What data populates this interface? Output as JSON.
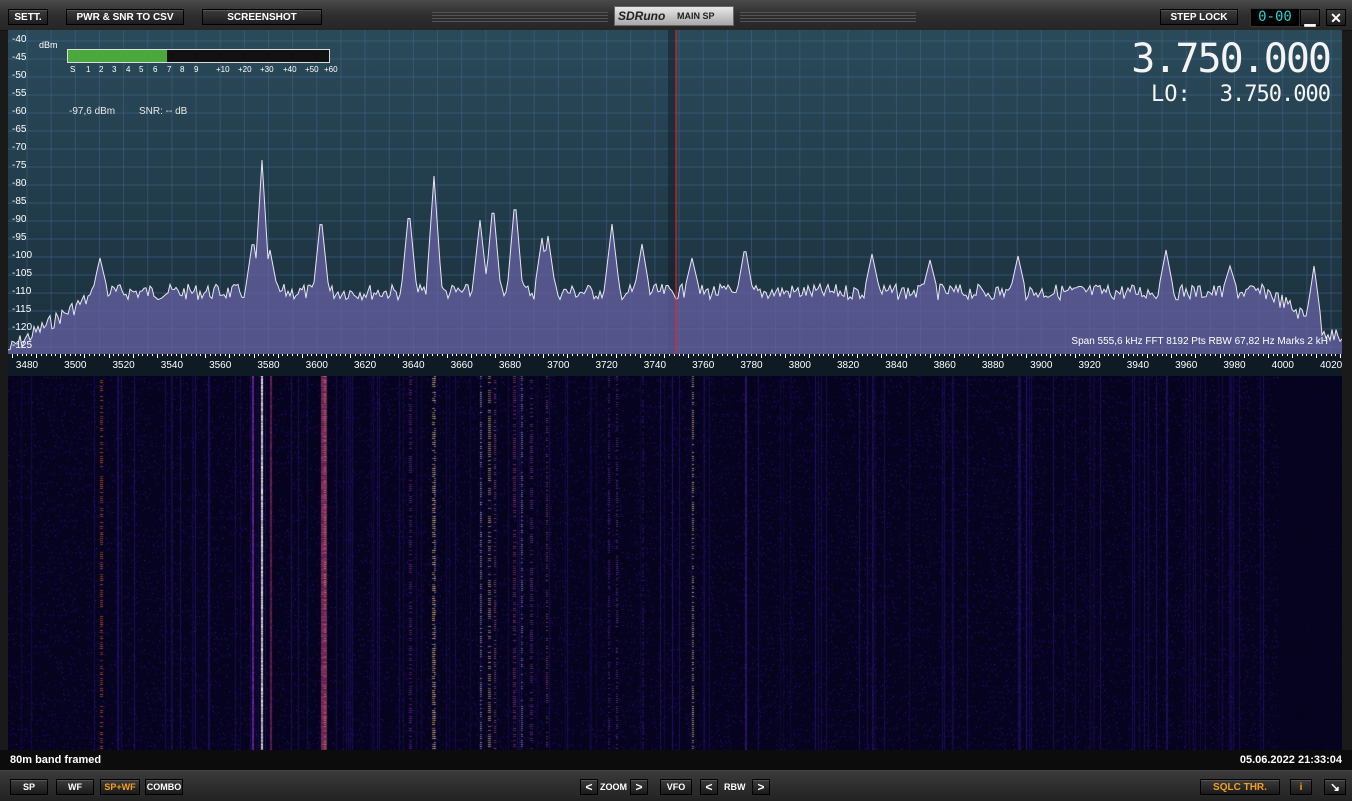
{
  "toolbar": {
    "settings": "SETT.",
    "pwr_snr": "PWR & SNR TO CSV",
    "screenshot": "SCREENSHOT",
    "logo": "SDRuno",
    "panel": "MAIN SP",
    "step_lock": "STEP LOCK",
    "clock": "0-00",
    "minimize": "▁",
    "close": "✕"
  },
  "spectrum": {
    "dbm_unit": "dBm",
    "db_scale": [
      "-40",
      "-45",
      "-50",
      "-55",
      "-60",
      "-65",
      "-70",
      "-75",
      "-80",
      "-85",
      "-90",
      "-95",
      "-100",
      "-105",
      "-110",
      "-115",
      "-120",
      "-125"
    ],
    "smeter_ticks": [
      "S",
      "1",
      "2",
      "3",
      "4",
      "5",
      "6",
      "7",
      "8",
      "9",
      "+10",
      "+20",
      "+30",
      "+40",
      "+50",
      "+60"
    ],
    "smeter_level": 0.38,
    "level": "-97,6 dBm",
    "snr": "SNR: -- dB",
    "frequency": "3.750.000",
    "lo_label": "LO:",
    "lo_value": "3.750.000",
    "info": "Span 555,6 kHz   FFT 8192 Pts   RBW 67,82 Hz   Marks 2 kH"
  },
  "axis": {
    "ticks": [
      "3480",
      "3500",
      "3520",
      "3540",
      "3560",
      "3580",
      "3600",
      "3620",
      "3640",
      "3660",
      "3680",
      "3700",
      "3720",
      "3740",
      "3760",
      "3780",
      "3800",
      "3820",
      "3840",
      "3860",
      "3880",
      "3900",
      "3920",
      "3940",
      "3960",
      "3980",
      "4000",
      "4020"
    ]
  },
  "status": {
    "left": "80m band framed",
    "right": "05.06.2022 21:33:04"
  },
  "bottom": {
    "sp": "SP",
    "wf": "WF",
    "spwf": "SP+WF",
    "combo": "COMBO",
    "zoom_prev": "<",
    "zoom": "ZOOM",
    "zoom_next": ">",
    "vfo": "VFO",
    "rbw_prev": "<",
    "rbw": "RBW",
    "rbw_next": ">",
    "sqlc": "SQLC THR.",
    "info": "i",
    "corner": "↘"
  },
  "colors": {
    "accent": "#f0a020",
    "spectrum_bg": "#2a4a5a",
    "spectrum_fill": "#6a62a8",
    "vfo_marker": "#ff2020",
    "smeter": "#4aa83c",
    "clock": "#22d3d3"
  }
}
